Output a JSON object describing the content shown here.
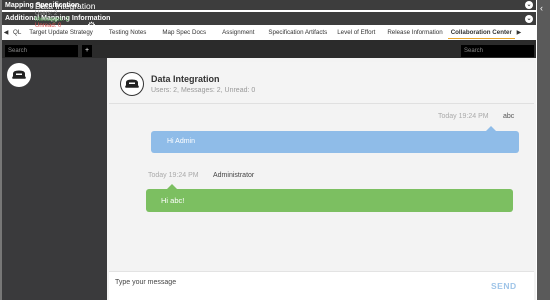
{
  "panels": {
    "mapping_specification": "Mapping Specification",
    "additional_mapping_information": "Additional Mapping Information"
  },
  "tabs": [
    {
      "label": "QL",
      "active": false
    },
    {
      "label": "Target Update Strategy",
      "active": false
    },
    {
      "label": "Testing Notes",
      "active": false
    },
    {
      "label": "Map Spec Docs",
      "active": false
    },
    {
      "label": "Assignment",
      "active": false
    },
    {
      "label": "Specification Artifacts",
      "active": false
    },
    {
      "label": "Level of Effort",
      "active": false
    },
    {
      "label": "Release Information",
      "active": false
    },
    {
      "label": "Collaboration Center",
      "active": true
    }
  ],
  "sidebar": {
    "search_placeholder": "Search",
    "add_label": "+",
    "conversation": {
      "name": "Data Integration",
      "users": "Users: 2",
      "messages": "Messages: 2",
      "unread": "Unread: 0"
    }
  },
  "chat": {
    "search_placeholder": "Search",
    "title": "Data Integration",
    "subtitle": "Users: 2, Messages: 2, Unread: 0",
    "messages": [
      {
        "time": "Today 19:24 PM",
        "user": "abc",
        "text": "Hi Admin",
        "side": "right",
        "color": "#8fbce8"
      },
      {
        "time": "Today 19:24 PM",
        "user": "Administrator",
        "text": "Hi abc!",
        "side": "left",
        "color": "#7cbf61"
      }
    ],
    "compose_placeholder": "Type your message",
    "send_label": "SEND"
  },
  "colors": {
    "bar_dark": "#3d3d3d",
    "sidebar": "#3a3a3c",
    "active_tab_underline": "#e7a52b",
    "unread_red": "#d9534f",
    "messages_green": "#69b86a"
  },
  "icons": {
    "conversation_avatar": "group-chat-icon",
    "settings": "gear-icon",
    "collapse": "chevron-down-icon"
  }
}
